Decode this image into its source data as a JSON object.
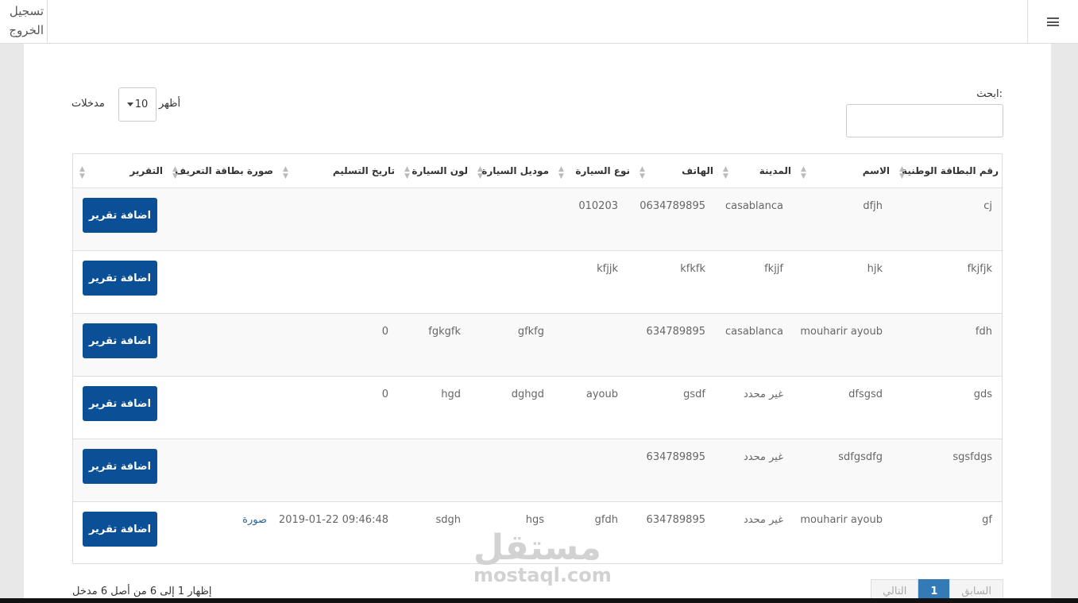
{
  "topbar": {
    "logout_label": "تسجيل الخروج",
    "menu_icon": "hamburger-icon"
  },
  "controls": {
    "search_label": "ابحث:",
    "length_show": "أظهر",
    "length_value": "10",
    "length_entries": "مدخلات"
  },
  "table": {
    "columns": [
      {
        "label": "رقم البطاقة الوطنية"
      },
      {
        "label": "الاسم"
      },
      {
        "label": "المدينة"
      },
      {
        "label": "الهاتف"
      },
      {
        "label": "نوع السيارة"
      },
      {
        "label": "موديل السيارة"
      },
      {
        "label": "لون السيارة"
      },
      {
        "label": "تاريخ التسليم"
      },
      {
        "label": "صورة بطاقة التعريف"
      },
      {
        "label": "التقرير"
      }
    ],
    "action_label": "اضافة تقرير",
    "rows": [
      {
        "id": "cj",
        "name": "dfjh",
        "city": "casablanca",
        "phone": "0634789895",
        "car_type": "010203",
        "car_model": "",
        "car_color": "",
        "delivery": "",
        "photo": ""
      },
      {
        "id": "fkjfjk",
        "name": "hjk",
        "city": "fkjjf",
        "phone": "kfkfk",
        "car_type": "kfjjk",
        "car_model": "",
        "car_color": "",
        "delivery": "",
        "photo": ""
      },
      {
        "id": "fdh",
        "name": "mouharir ayoub",
        "city": "casablanca",
        "phone": "634789895",
        "car_type": "",
        "car_model": "gfkfg",
        "car_color": "fgkgfk",
        "delivery": "0",
        "photo": ""
      },
      {
        "id": "gds",
        "name": "dfsgsd",
        "city": "غير محدد",
        "phone": "gsdf",
        "car_type": "ayoub",
        "car_model": "dghgd",
        "car_color": "hgd",
        "delivery": "0",
        "photo": ""
      },
      {
        "id": "sgsfdgs",
        "name": "sdfgsdfg",
        "city": "غير محدد",
        "phone": "634789895",
        "car_type": "",
        "car_model": "",
        "car_color": "",
        "delivery": "",
        "photo": ""
      },
      {
        "id": "gf",
        "name": "mouharir ayoub",
        "city": "غير محدد",
        "phone": "634789895",
        "car_type": "gfdh",
        "car_model": "hgs",
        "car_color": "sdgh",
        "delivery": "2019-01-22 09:46:48",
        "photo": "صورة"
      }
    ]
  },
  "footer": {
    "info": "إظهار 1 إلى 6 من أصل 6 مدخل",
    "prev": "السابق",
    "page": "1",
    "next": "التالي"
  },
  "watermark": {
    "text": "مستقل",
    "subtext": "mostaql.com"
  },
  "colors": {
    "button": "#0b4f96",
    "active_page": "#337ab7",
    "link": "#2a6496"
  }
}
